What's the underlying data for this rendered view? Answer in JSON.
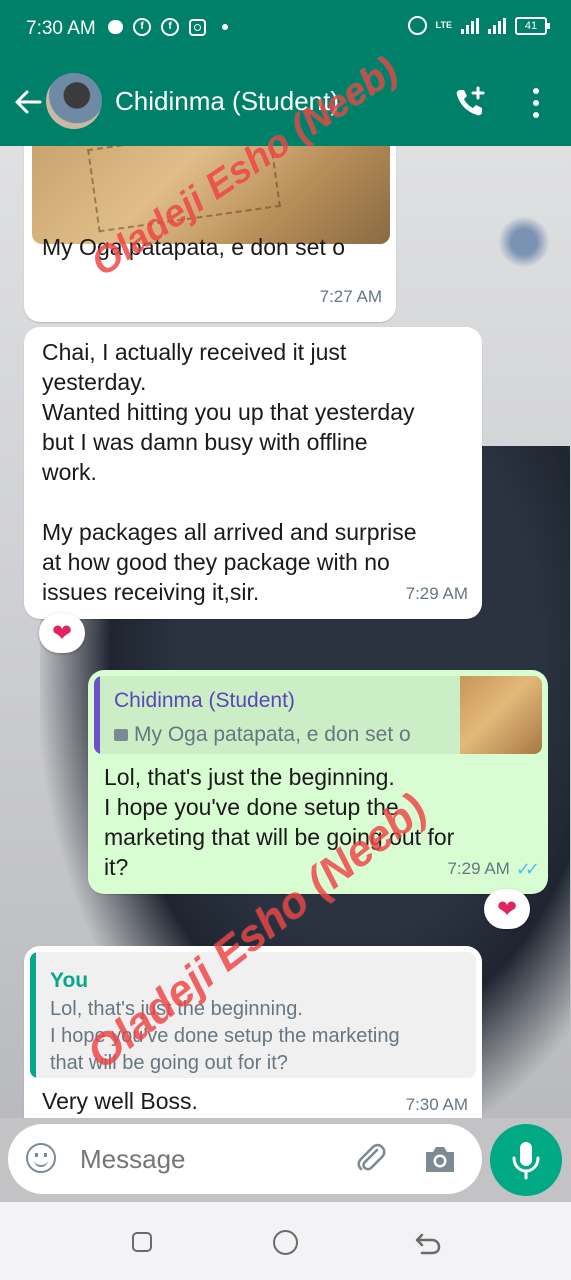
{
  "status_bar": {
    "time": "7:30 AM",
    "network": "LTE",
    "battery": "41"
  },
  "header": {
    "contact_name": "Chidinma (Student)"
  },
  "messages": [
    {
      "id": "m1",
      "direction": "incoming",
      "has_image": true,
      "text": "My Oga patapata, e don set o",
      "time": "7:27 AM"
    },
    {
      "id": "m2",
      "direction": "incoming",
      "text": "Chai, I actually received it just\nyesterday.\nWanted hitting you up that yesterday\nbut I was damn busy with offline\nwork.\n\nMy packages all arrived and surprise\nat how good they package with no\nissues receiving it,sir.",
      "time": "7:29 AM",
      "reaction": "❤"
    },
    {
      "id": "m3",
      "direction": "outgoing",
      "quote": {
        "author": "Chidinma (Student)",
        "text": "My Oga patapata, e don set o"
      },
      "text": "Lol, that's just the beginning.\nI hope you've done setup the\nmarketing that will be going out for\nit?",
      "time": "7:29 AM",
      "read_ticks": "✓✓",
      "reaction": "❤"
    },
    {
      "id": "m4",
      "direction": "incoming",
      "quote": {
        "author": "You",
        "text": "Lol, that's just the beginning.\nI hope you've done setup the marketing\nthat will be going out for it?"
      },
      "text": "Very well Boss.",
      "time": "7:30 AM"
    }
  ],
  "watermark": "Oladeji Esho (Neeb)",
  "composer": {
    "placeholder": "Message"
  },
  "colors": {
    "header": "#008069",
    "outgoing_bubble": "#d9fdd3",
    "mic_button": "#00a884",
    "watermark": "#eb2828"
  }
}
